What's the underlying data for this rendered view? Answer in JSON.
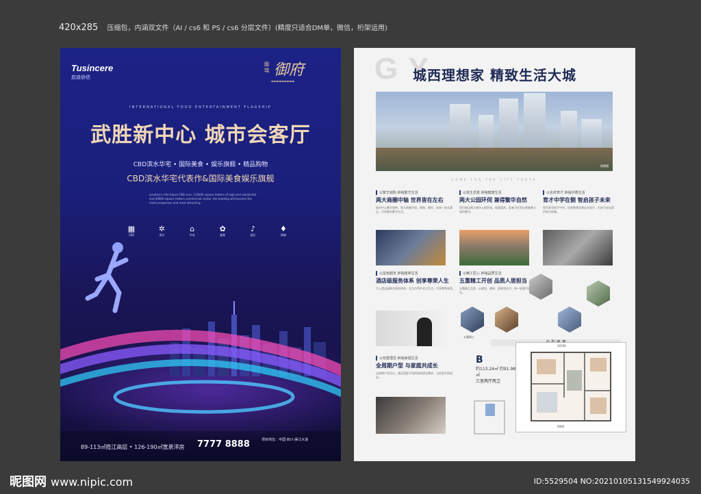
{
  "header": {
    "size": "420x285",
    "description": "压缩包，内涵双文件（AI / cs6 和 PS / cs6 分层文件）(精度只适合DM单，微信，桁架运用)"
  },
  "left_poster": {
    "brand": "Tusincere",
    "brand_sub": "启迪协信",
    "logo_small": "國瑞",
    "logo_main": "御府",
    "logo_tag": "▬▬▬▬▬▬▬▬▬",
    "intl_line": "INTERNATIONAL FOOD ENTERTAINMENT FLAGSHIP",
    "headline": "武胜新中心  城市会客厅",
    "sub1": "CBD滨水华宅 • 国际美食 • 娱乐旗舰 • 精品购物",
    "sub2": "CBD滨水华宅代表作&国际美食娱乐旗舰",
    "english": "Located in the future CBD core, 110000 square meters of high-end residential and 40000 square meters commercial center, the building will become the most prosperous and most attracting.",
    "icons": [
      {
        "name": "building-icon",
        "glyph": "▦",
        "label": "CBD"
      },
      {
        "name": "gear-icon",
        "glyph": "✲",
        "label": "滨水"
      },
      {
        "name": "home-icon",
        "glyph": "⌂",
        "label": "华宅"
      },
      {
        "name": "food-icon",
        "glyph": "✿",
        "label": "美食"
      },
      {
        "name": "music-icon",
        "glyph": "♪",
        "label": "娱乐"
      },
      {
        "name": "bag-icon",
        "glyph": "♦",
        "label": "购物"
      }
    ],
    "footer_area": "89-113㎡揽江高层 • 126-190㎡宽景洋房",
    "footer_phone": "7777  8888",
    "footer_address": "项目地址：中国·四川·渠江大道"
  },
  "right_poster": {
    "ghost_text": "G          Y",
    "title": "城西理想家  精致生活大城",
    "hero_caption": "效果图",
    "tagline": "COME FOR THE CITY YOUTH",
    "blocks": [
      {
        "tag": "以繁华城购  醉袖繁华生活",
        "title": "两大商圈中轴 世界皆在左右",
        "body": "城市中心繁华地带，两大商圈环绕，购物、餐饮、休闲一站式满足，尽享都市繁华生活。"
      },
      {
        "tag": "以有生态景  醉袖健康生活",
        "title": "两大公园环伺 兼得繁华自然",
        "body": "项目周边两大城市公园环绕，绿意盎然，居者可尽享自然美景与城市繁华。"
      },
      {
        "tag": "以名校育才  醉袖书香生活",
        "title": "育才中学在侧 智启孩子未来",
        "body": "项目紧邻育才中学，优质教育资源近在咫尺，为孩子成长提供有力保障。"
      },
      {
        "tag": "以星级服务  醉袖尊荣生活",
        "title": "酒店级服务体系 创享尊荣人生",
        "body": "引入酒店级物业服务体系，全方位呵护业主生活，尽享尊荣体验。"
      },
      {
        "tag": "以精工匠心  醉袖品质生活",
        "title": "五重精工开创 品质人居担当",
        "body": "五重精工品质，从规划、建筑、园林到交付，每一处细节皆为品质而生。"
      },
      {
        "tag": "以有墅理念  醉袖幸福生活",
        "title": "全周期户型 与家庭共成长",
        "body": "全周期户型设计，满足家庭不同阶段的居住需求，与家庭共同成长。"
      }
    ],
    "hex_caption": "五重精工",
    "fp_header": "户 型 鉴 赏",
    "fp_label": "B",
    "fp_area": "约113.24㎡ 约91.98㎡",
    "fp_rooms": "三室两厅两卫",
    "dim_top": "10150",
    "dim_bottom": "6900"
  },
  "watermark": {
    "logo": "昵图网",
    "url": "www.nipic.com",
    "id": "ID:5529504 NO:20210105131549924035"
  }
}
